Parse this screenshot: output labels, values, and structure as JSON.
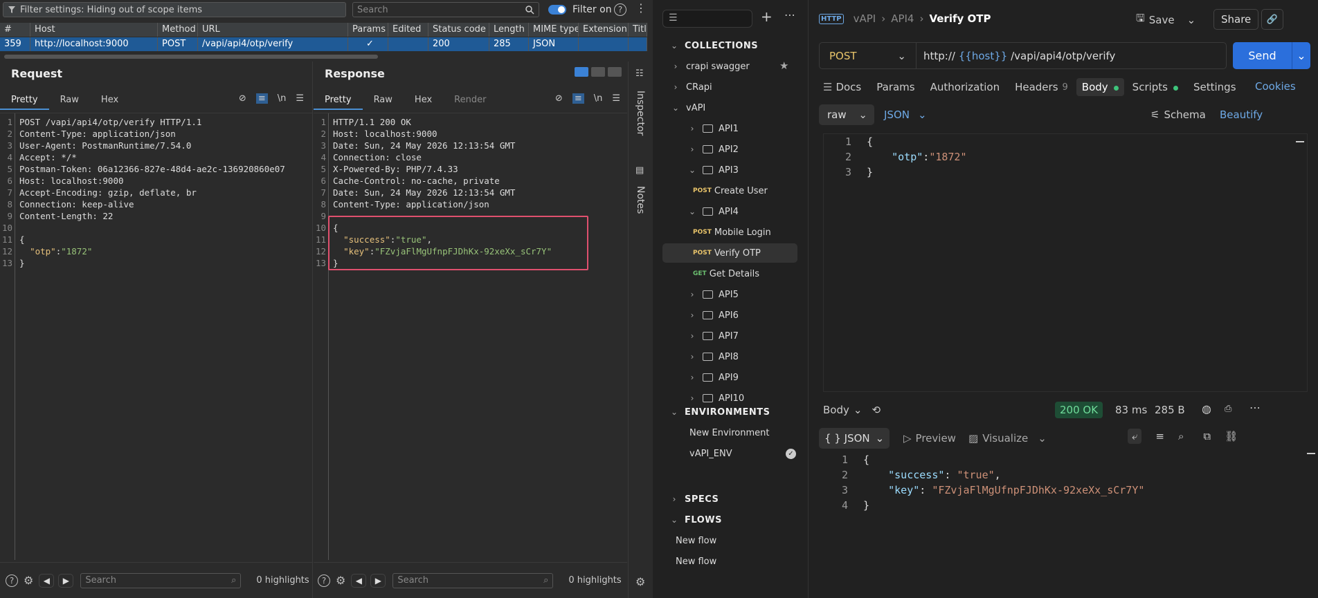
{
  "burp": {
    "filter_text": "Filter settings: Hiding out of scope items",
    "search_placeholder": "Search",
    "filter_on_label": "Filter on",
    "columns": [
      "#",
      "Host",
      "Method",
      "URL",
      "Params",
      "Edited",
      "Status code",
      "Length",
      "MIME type",
      "Extension",
      "Title"
    ],
    "row": {
      "num": "359",
      "host": "http://localhost:9000",
      "method": "POST",
      "url": "/vapi/api4/otp/verify",
      "params": "✓",
      "edited": "",
      "status": "200",
      "length": "285",
      "mime": "JSON",
      "extension": "",
      "title": ""
    },
    "request": {
      "title": "Request",
      "tabs": [
        "Pretty",
        "Raw",
        "Hex"
      ],
      "lines": [
        "POST /vapi/api4/otp/verify HTTP/1.1",
        "Content-Type: application/json",
        "User-Agent: PostmanRuntime/7.54.0",
        "Accept: */*",
        "Postman-Token: 06a12366-827e-48d4-ae2c-136920860e07",
        "Host: localhost:9000",
        "Accept-Encoding: gzip, deflate, br",
        "Connection: keep-alive",
        "Content-Length: 22",
        "",
        "{",
        "  \"otp\":\"1872\"",
        "}"
      ],
      "search_placeholder": "Search",
      "highlights": "0 highlights"
    },
    "response": {
      "title": "Response",
      "tabs": [
        "Pretty",
        "Raw",
        "Hex",
        "Render"
      ],
      "lines": [
        "HTTP/1.1 200 OK",
        "Host: localhost:9000",
        "Date: Sun, 24 May 2026 12:13:54 GMT",
        "Connection: close",
        "X-Powered-By: PHP/7.4.33",
        "Cache-Control: no-cache, private",
        "Date: Sun, 24 May 2026 12:13:54 GMT",
        "Content-Type: application/json",
        "",
        "{",
        "  \"success\":\"true\",",
        "  \"key\":\"FZvjaFlMgUfnpFJDhKx-92xeXx_sCr7Y\"",
        "}"
      ],
      "search_placeholder": "Search",
      "highlights": "0 highlights"
    },
    "side_tabs": [
      "Inspector",
      "Notes"
    ]
  },
  "postman": {
    "sidebar": {
      "collections_label": "COLLECTIONS",
      "items": [
        {
          "label": "crapi swagger",
          "type": "collection"
        },
        {
          "label": "CRapi",
          "type": "collection"
        },
        {
          "label": "vAPI",
          "type": "collection"
        },
        {
          "label": "API1",
          "type": "folder"
        },
        {
          "label": "API2",
          "type": "folder"
        },
        {
          "label": "API3",
          "type": "folder"
        },
        {
          "label": "Create User",
          "type": "request",
          "method": "POST"
        },
        {
          "label": "API4",
          "type": "folder"
        },
        {
          "label": "Mobile Login",
          "type": "request",
          "method": "POST"
        },
        {
          "label": "Verify OTP",
          "type": "request",
          "method": "POST"
        },
        {
          "label": "Get Details",
          "type": "request",
          "method": "GET"
        },
        {
          "label": "API5",
          "type": "folder"
        },
        {
          "label": "API6",
          "type": "folder"
        },
        {
          "label": "API7",
          "type": "folder"
        },
        {
          "label": "API8",
          "type": "folder"
        },
        {
          "label": "API9",
          "type": "folder"
        },
        {
          "label": "API10",
          "type": "folder"
        }
      ],
      "environments_label": "ENVIRONMENTS",
      "envs": [
        "New Environment",
        "vAPI_ENV"
      ],
      "specs_label": "SPECS",
      "flows_label": "FLOWS",
      "flows": [
        "New flow",
        "New flow"
      ]
    },
    "header": {
      "breadcrumb_1": "vAPI",
      "breadcrumb_2": "API4",
      "title": "Verify OTP",
      "save": "Save",
      "share": "Share"
    },
    "request": {
      "method": "POST",
      "url_prefix": "http://",
      "url_var": "{{host}}",
      "url_path": "/vapi/api4/otp/verify",
      "send": "Send",
      "tabs": [
        "Docs",
        "Params",
        "Authorization",
        "Headers",
        "Body",
        "Scripts",
        "Settings"
      ],
      "headers_count": "9",
      "cookies": "Cookies",
      "body_mode": "raw",
      "body_format": "JSON",
      "schema": "Schema",
      "beautify": "Beautify",
      "body_lines": [
        "{",
        "    \"otp\":\"1872\"",
        "}"
      ]
    },
    "response": {
      "body_label": "Body",
      "status": "200 OK",
      "time": "83 ms",
      "size": "285 B",
      "format": "{ } JSON",
      "preview": "Preview",
      "visualize": "Visualize",
      "lines": [
        "{",
        "    \"success\": \"true\",",
        "    \"key\": \"FZvjaFlMgUfnpFJDhKx-92xeXx_sCr7Y\"",
        "}"
      ]
    }
  }
}
